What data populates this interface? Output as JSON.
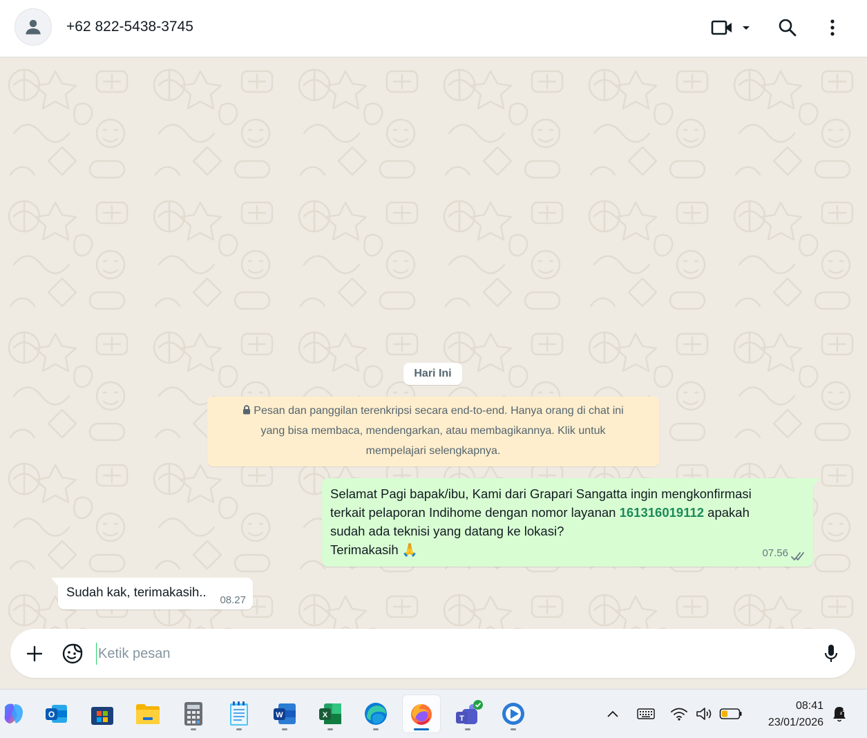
{
  "header": {
    "contact_name": "+62 822-5438-3745",
    "icons": [
      "video-call-icon",
      "chevron-down-icon",
      "search-icon",
      "more-options-icon"
    ]
  },
  "chat": {
    "date_chip": "Hari Ini",
    "encryption_notice": {
      "line1": "Pesan dan panggilan terenkripsi secara end-to-end. Hanya orang di chat ini",
      "line2": "yang bisa membaca, mendengarkan, atau membagikannya. Klik untuk",
      "line3": "mempelajari selengkapnya."
    },
    "outgoing_message": {
      "line1": "Selamat Pagi bapak/ibu, Kami dari Grapari Sangatta ingin mengkonfirmasi",
      "line2_pre": "terkait pelaporan Indihome dengan nomor layanan ",
      "line2_number": "161316019112",
      "line2_post": " apakah",
      "line3": "sudah ada teknisi yang datang ke lokasi?",
      "line4": "Terimakasih",
      "emoji": "🙏",
      "time": "07.56",
      "status": "read"
    },
    "incoming_message": {
      "text": "Sudah kak, terimakasih..",
      "time": "08.27"
    }
  },
  "composer": {
    "placeholder": "Ketik pesan",
    "value": ""
  },
  "taskbar": {
    "apps": [
      {
        "name": "copilot-icon",
        "running": false
      },
      {
        "name": "outlook-icon",
        "running": false
      },
      {
        "name": "microsoft-store-icon",
        "running": false
      },
      {
        "name": "file-explorer-icon",
        "running": false
      },
      {
        "name": "calculator-icon",
        "running": true
      },
      {
        "name": "notepad-icon",
        "running": true
      },
      {
        "name": "word-icon",
        "running": true
      },
      {
        "name": "excel-icon",
        "running": true
      },
      {
        "name": "edge-icon",
        "running": true
      },
      {
        "name": "firefox-icon",
        "running": true,
        "active": true
      },
      {
        "name": "teams-icon",
        "running": true
      },
      {
        "name": "media-player-icon",
        "running": true
      }
    ],
    "clock": {
      "time": "08:41",
      "date": "23/01/2026"
    }
  },
  "colors": {
    "chat_background": "#efeae2",
    "outgoing_bubble": "#d9fdd3",
    "incoming_bubble": "#ffffff",
    "encryption_notice_bg": "#ffeecd",
    "accent_green": "#1b8a5a",
    "read_ticks": "#667781"
  }
}
